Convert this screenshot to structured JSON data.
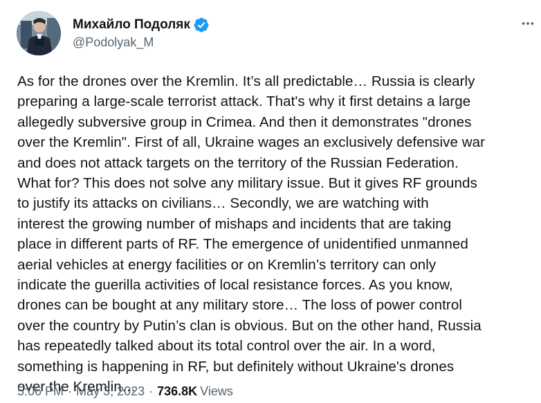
{
  "author": {
    "display_name": "Михайло Подоляк",
    "handle": "@Podolyak_M",
    "verified_color": "#1d9bf0"
  },
  "icons": {
    "verified": "verified-badge-icon",
    "more": "more-horizontal-icon"
  },
  "tweet": {
    "text": "As for the drones over the Kremlin. It’s all predictable… Russia is clearly\npreparing a large-scale terrorist attack. That's why it first detains a large\nallegedly subversive group in Crimea. And then it demonstrates \"drones\nover the Kremlin\". First of all, Ukraine wages an exclusively defensive war\nand does not attack targets on the territory of the Russian Federation.\nWhat for? This does not solve any military issue. But it gives RF grounds\nto justify its attacks on civilians… Secondly, we are watching with\ninterest the growing number of mishaps and incidents that are taking\nplace in different parts of RF. The emergence of unidentified unmanned\naerial vehicles at energy facilities or on Kremlin’s territory can only\nindicate the guerilla activities of local resistance forces. As you know,\ndrones can be bought at any military store… The loss of power control\nover the country by Putin’s clan is obvious. But on the other hand, Russia\nhas repeatedly talked about its total control over the air. In a word,\nsomething is happening in RF, but definitely without Ukraine's drones\nover the Kremlin…",
    "time": "5:06 PM",
    "separator": "·",
    "date": "May 3, 2023",
    "views_count": "736.8K",
    "views_label": "Views"
  }
}
